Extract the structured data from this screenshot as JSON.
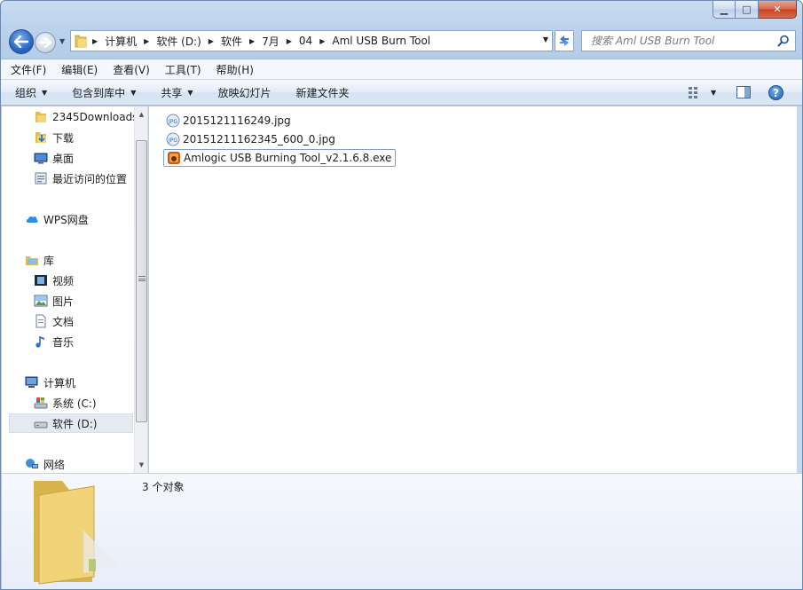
{
  "window": {
    "min_label": "▁",
    "max_label": "□",
    "close_label": "✕"
  },
  "address": {
    "crumbs": [
      "计算机",
      "软件 (D:)",
      "软件",
      "7月",
      "04",
      "Aml USB Burn Tool"
    ],
    "search_placeholder": "搜索 Aml USB Burn Tool"
  },
  "menu": [
    "文件(F)",
    "编辑(E)",
    "查看(V)",
    "工具(T)",
    "帮助(H)"
  ],
  "toolbar": {
    "organize": "组织",
    "include_in_library": "包含到库中",
    "share": "共享",
    "slideshow": "放映幻灯片",
    "new_folder": "新建文件夹"
  },
  "nav": {
    "favorites": [
      "2345Downloads",
      "下载",
      "桌面",
      "最近访问的位置"
    ],
    "wps": "WPS网盘",
    "libraries": "库",
    "library_items": [
      "视频",
      "图片",
      "文档",
      "音乐"
    ],
    "computer": "计算机",
    "drives": [
      "系统 (C:)",
      "软件 (D:)"
    ],
    "network": "网络"
  },
  "files": [
    {
      "name": "2015121116249.jpg",
      "icon": "jpg-icon"
    },
    {
      "name": "20151211162345_600_0.jpg",
      "icon": "jpg-icon"
    },
    {
      "name": "Amlogic USB Burning Tool_v2.1.6.8.exe",
      "icon": "exe-icon",
      "selected": true
    }
  ],
  "details": {
    "count": "3 个对象"
  }
}
